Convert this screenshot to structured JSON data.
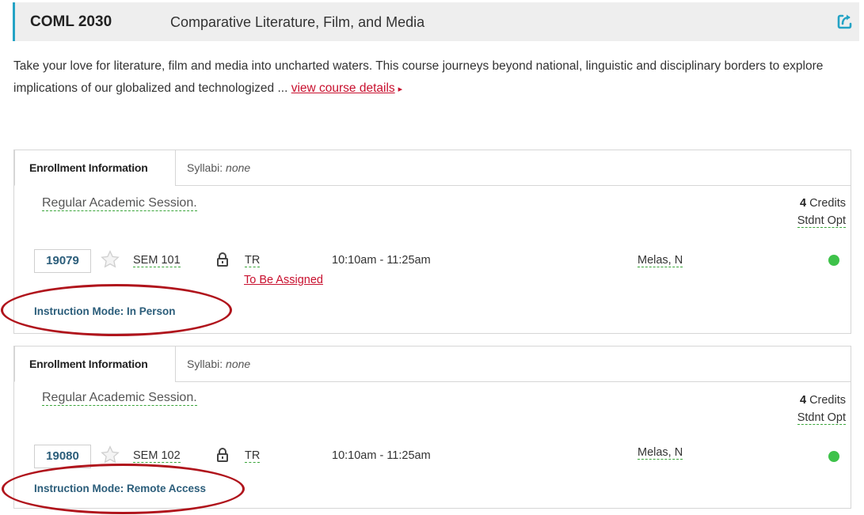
{
  "course": {
    "code": "COML 2030",
    "title": "Comparative Literature, Film, and Media",
    "description": "Take your love for literature, film and media into uncharted waters. This course journeys beyond national, linguistic and disciplinary borders to explore implications of our globalized and technologized ...",
    "details_link": "view course details",
    "details_caret": "▸"
  },
  "sections": [
    {
      "tab_enrollment": "Enrollment Information",
      "syllabi_label": "Syllabi:",
      "syllabi_value": "none",
      "session": "Regular Academic Session.",
      "credits_num": "4",
      "credits_label": "Credits",
      "grading": "Stdnt Opt",
      "class_number": "19079",
      "component": "SEM 101",
      "days": "TR",
      "location": "To Be Assigned",
      "time": "10:10am - 11:25am",
      "instructor": "Melas, N",
      "instruction_mode": "Instruction Mode: In Person"
    },
    {
      "tab_enrollment": "Enrollment Information",
      "syllabi_label": "Syllabi:",
      "syllabi_value": "none",
      "session": "Regular Academic Session.",
      "credits_num": "4",
      "credits_label": "Credits",
      "grading": "Stdnt Opt",
      "class_number": "19080",
      "component": "SEM 102",
      "days": "TR",
      "location": "",
      "time": "10:10am - 11:25am",
      "instructor": "Melas, N",
      "instruction_mode": "Instruction Mode: Remote Access"
    }
  ],
  "colors": {
    "accent": "#24a3c5",
    "link": "#c8102e",
    "class_number": "#2b5d7a",
    "open_status": "#3ec24a",
    "annotation": "#b0141c"
  },
  "icons": [
    "share-icon",
    "star-icon",
    "lock-icon",
    "status-open-icon"
  ]
}
